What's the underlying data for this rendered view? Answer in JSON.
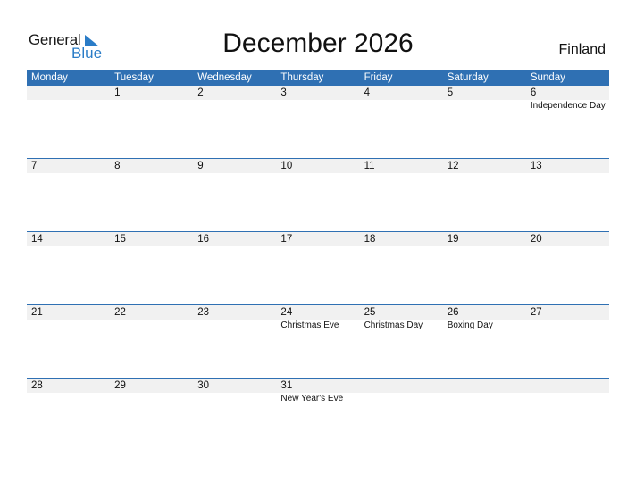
{
  "logo": {
    "part1": "General",
    "part2": "Blue"
  },
  "header": {
    "title": "December 2026",
    "country": "Finland"
  },
  "weekdays": [
    "Monday",
    "Tuesday",
    "Wednesday",
    "Thursday",
    "Friday",
    "Saturday",
    "Sunday"
  ],
  "weeks": [
    {
      "days": [
        "",
        "1",
        "2",
        "3",
        "4",
        "5",
        "6"
      ],
      "events": [
        "",
        "",
        "",
        "",
        "",
        "",
        "Independence Day"
      ]
    },
    {
      "days": [
        "7",
        "8",
        "9",
        "10",
        "11",
        "12",
        "13"
      ],
      "events": [
        "",
        "",
        "",
        "",
        "",
        "",
        ""
      ]
    },
    {
      "days": [
        "14",
        "15",
        "16",
        "17",
        "18",
        "19",
        "20"
      ],
      "events": [
        "",
        "",
        "",
        "",
        "",
        "",
        ""
      ]
    },
    {
      "days": [
        "21",
        "22",
        "23",
        "24",
        "25",
        "26",
        "27"
      ],
      "events": [
        "",
        "",
        "",
        "Christmas Eve",
        "Christmas Day",
        "Boxing Day",
        ""
      ]
    },
    {
      "days": [
        "28",
        "29",
        "30",
        "31",
        "",
        "",
        ""
      ],
      "events": [
        "",
        "",
        "",
        "New Year's Eve",
        "",
        "",
        ""
      ]
    }
  ]
}
